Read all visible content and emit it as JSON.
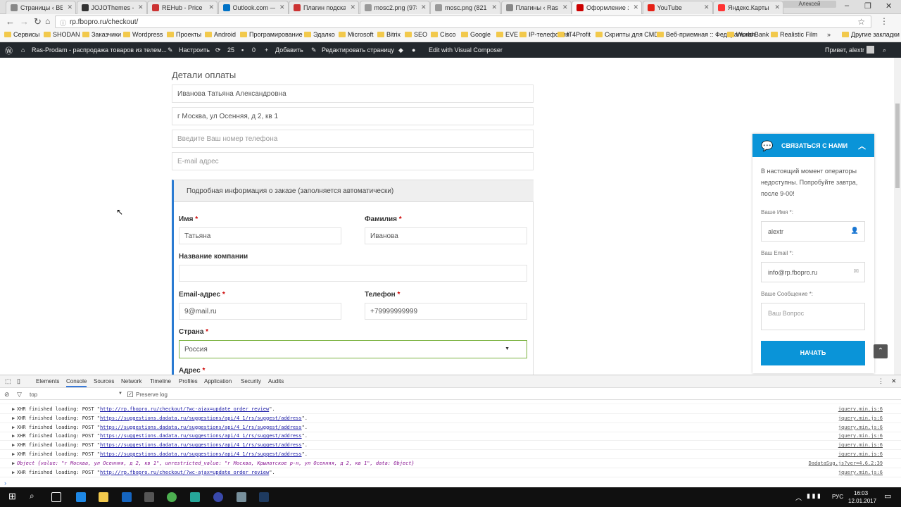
{
  "browser": {
    "tabs": [
      {
        "label": "Страницы ‹ BEC",
        "color": "#888"
      },
      {
        "label": "JOJOThemes - D",
        "color": "#333"
      },
      {
        "label": "REHub - Price C",
        "color": "#c33"
      },
      {
        "label": "Outlook.com —",
        "color": "#0072c6"
      },
      {
        "label": "Плагин подсказ",
        "color": "#c33"
      },
      {
        "label": "mosc2.png (978",
        "color": "#999"
      },
      {
        "label": "mosc.png (821 ×",
        "color": "#999"
      },
      {
        "label": "Плагины ‹ Ras-P",
        "color": "#888"
      },
      {
        "label": "Оформление за",
        "color": "#c00"
      },
      {
        "label": "YouTube",
        "color": "#e62117"
      },
      {
        "label": "Яндекс.Карты –",
        "color": "#f33"
      }
    ],
    "user_chip": "Алексей",
    "url": "rp.fbopro.ru/checkout/",
    "bookmarks": [
      "Сервисы",
      "SHODAN",
      "Заказчики",
      "Wordpress",
      "Проекты",
      "Android",
      "Програмирование",
      "Эдалко",
      "Microsoft",
      "Bitrix",
      "SEO",
      "Cisco",
      "Google",
      "EVE",
      "IP-телефония",
      "IT4Profit",
      "Скрипты для CMD",
      "Веб-приемная :: Федеральная",
      "World Bank",
      "Realistic Film"
    ],
    "bookmarks_more": "»",
    "bookmarks_other": "Другие закладки"
  },
  "wpbar": {
    "site": "Ras-Prodam - распродажа товаров из телем...",
    "customize": "Настроить",
    "updates": "25",
    "comments": "0",
    "add": "Добавить",
    "edit_page": "Редактировать страницу",
    "visual_composer": "Edit with Visual Composer",
    "greeting": "Привет, alextr"
  },
  "checkout": {
    "section_title": "Детали оплаты",
    "fullname": "Иванова Татьяна Александровна",
    "address": "г Москва, ул Осенняя, д 2, кв 1",
    "phone_placeholder": "Введите Ваш номер телефона",
    "email_placeholder": "E-mail адрес",
    "order_title": "Подробная информация о заказе (заполняется автоматически)",
    "first_name_label": "Имя",
    "first_name": "Татьяна",
    "last_name_label": "Фамилия",
    "last_name": "Иванова",
    "company_label": "Название компании",
    "email_label": "Email-адрес",
    "email": "9@mail.ru",
    "phone_label": "Телефон",
    "phone": "+79999999999",
    "country_label": "Страна",
    "country": "Россия",
    "address_label": "Адрес",
    "required_mark": "*"
  },
  "chat": {
    "title": "СВЯЗАТЬСЯ С НАМИ",
    "notice": "В настоящий момент операторы недоступны. Попробуйте завтра, после 9-00!",
    "name_label": "Ваше Имя *:",
    "name_value": "alextr",
    "email_label": "Ваш Email *:",
    "email_value": "info@rp.fbopro.ru",
    "message_label": "Ваше Сообщение *:",
    "message_placeholder": "Ваш Вопрос",
    "submit": "НАЧАТЬ"
  },
  "devtools": {
    "tabs": [
      "Elements",
      "Console",
      "Sources",
      "Network",
      "Timeline",
      "Profiles",
      "Application",
      "Security",
      "Audits"
    ],
    "active_tab": "Console",
    "context": "top",
    "preserve_log": "Preserve log",
    "logs": [
      {
        "prefix": "XHR finished loading: POST \"",
        "url": "http://rp.fbopro.ru/checkout/?wc-ajax=update_order_review",
        "suffix": "\".",
        "src": "jquery.min.js:6"
      },
      {
        "prefix": "XHR finished loading: POST \"",
        "url": "https://suggestions.dadata.ru/suggestions/api/4_1/rs/suggest/address",
        "suffix": "\".",
        "src": "jquery.min.js:6"
      },
      {
        "prefix": "XHR finished loading: POST \"",
        "url": "https://suggestions.dadata.ru/suggestions/api/4_1/rs/suggest/address",
        "suffix": "\".",
        "src": "jquery.min.js:6"
      },
      {
        "prefix": "XHR finished loading: POST \"",
        "url": "https://suggestions.dadata.ru/suggestions/api/4_1/rs/suggest/address",
        "suffix": "\".",
        "src": "jquery.min.js:6"
      },
      {
        "prefix": "XHR finished loading: POST \"",
        "url": "https://suggestions.dadata.ru/suggestions/api/4_1/rs/suggest/address",
        "suffix": "\".",
        "src": "jquery.min.js:6"
      },
      {
        "prefix": "XHR finished loading: POST \"",
        "url": "https://suggestions.dadata.ru/suggestions/api/4_1/rs/suggest/address",
        "suffix": "\".",
        "src": "jquery.min.js:6"
      },
      {
        "prefix": "Object {value: \"г Москва, ул Осенняя, д 2, кв 1\", unrestricted_value: \"г Москва, Крылатское р-н, ул Осенняя, д 2, кв 1\", data: Object}",
        "url": "",
        "suffix": "",
        "src": "DadataSug.js?ver=4.6.2:39"
      },
      {
        "prefix": "XHR finished loading: POST \"",
        "url": "http://rp.fbopro.ru/checkout/?wc-ajax=update_order_review",
        "suffix": "\".",
        "src": "jquery.min.js:6"
      }
    ]
  },
  "taskbar": {
    "lang": "РУС",
    "time": "16:03",
    "date": "12.01.2017"
  }
}
